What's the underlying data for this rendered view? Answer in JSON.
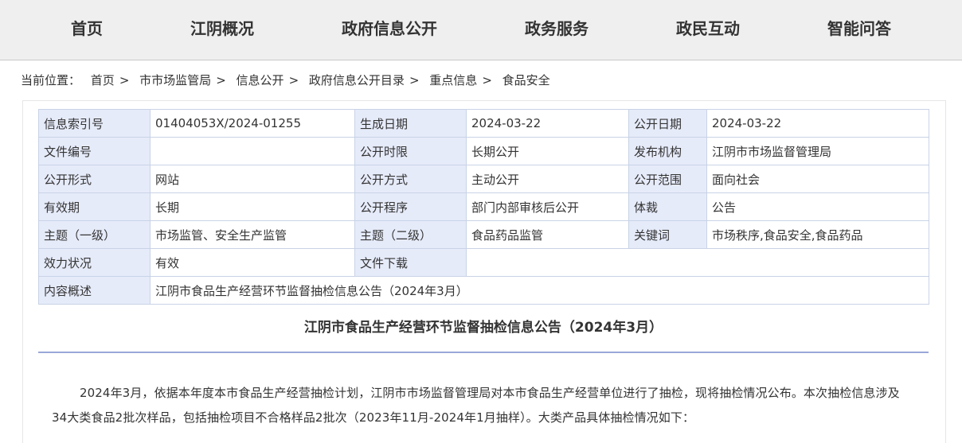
{
  "nav": {
    "items": [
      "首页",
      "江阴概况",
      "政府信息公开",
      "政务服务",
      "政民互动",
      "智能问答"
    ]
  },
  "breadcrumb": {
    "prefix": "当前位置：",
    "items": [
      "首页",
      "市市场监管局",
      "信息公开",
      "政府信息公开目录",
      "重点信息",
      "食品安全"
    ],
    "separator": ">"
  },
  "meta": {
    "index_label": "信息索引号",
    "index_value": "01404053X/2024-01255",
    "gen_date_label": "生成日期",
    "gen_date_value": "2024-03-22",
    "pub_date_label": "公开日期",
    "pub_date_value": "2024-03-22",
    "doc_no_label": "文件编号",
    "doc_no_value": "",
    "term_label": "公开时限",
    "term_value": "长期公开",
    "org_label": "发布机构",
    "org_value": "江阴市市场监督管理局",
    "form_label": "公开形式",
    "form_value": "网站",
    "method_label": "公开方式",
    "method_value": "主动公开",
    "scope_label": "公开范围",
    "scope_value": "面向社会",
    "validity_label": "有效期",
    "validity_value": "长期",
    "procedure_label": "公开程序",
    "procedure_value": "部门内部审核后公开",
    "genre_label": "体裁",
    "genre_value": "公告",
    "topic1_label": "主题（一级）",
    "topic1_value": "市场监管、安全生产监管",
    "topic2_label": "主题（二级）",
    "topic2_value": "食品药品监管",
    "keywords_label": "关键词",
    "keywords_value": "市场秩序,食品安全,食品药品",
    "status_label": "效力状况",
    "status_value": "有效",
    "download_label": "文件下载",
    "download_value": "",
    "summary_label": "内容概述",
    "summary_value": "江阴市食品生产经营环节监督抽检信息公告（2024年3月）"
  },
  "article": {
    "title": "江阴市食品生产经营环节监督抽检信息公告（2024年3月）",
    "paragraph": "2024年3月，依据本年度本市食品生产经营抽检计划，江阴市市场监督管理局对本市食品生产经营单位进行了抽检，现将抽检情况公布。本次抽检信息涉及34大类食品2批次样品，包括抽检项目不合格样品2批次（2023年11月-2024年1月抽样）。大类产品具体抽检情况如下："
  },
  "colors": {
    "nav_bg": "#efefef",
    "label_bg": "#e6ebfa",
    "border": "#c9d3e6",
    "divider": "#9aa8d8"
  }
}
